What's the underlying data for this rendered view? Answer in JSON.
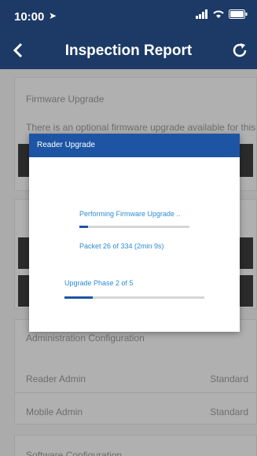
{
  "status": {
    "time": "10:00"
  },
  "nav": {
    "title": "Inspection Report"
  },
  "background": {
    "firmware_card": {
      "title": "Firmware Upgrade",
      "text": "There is an optional firmware upgrade available for this"
    },
    "admin_card": {
      "title": "Administration Configuration",
      "rows": [
        {
          "label": "Reader Admin",
          "value": "Standard"
        },
        {
          "label": "Mobile Admin",
          "value": "Standard"
        }
      ]
    },
    "software_card": {
      "title": "Software Configuration"
    }
  },
  "dialog": {
    "title": "Reader Upgrade",
    "firmware_label": "Performing Firmware Upgrade ..",
    "firmware_progress": 0.078,
    "packet_text": "Packet 26 of 334 (2min 9s)",
    "phase_label": "Upgrade Phase 2 of 5",
    "phase_progress": 0.2
  },
  "colors": {
    "nav": "#1d3a66",
    "dialog_header": "#1d55a4",
    "accent_text": "#2d8bd6"
  }
}
